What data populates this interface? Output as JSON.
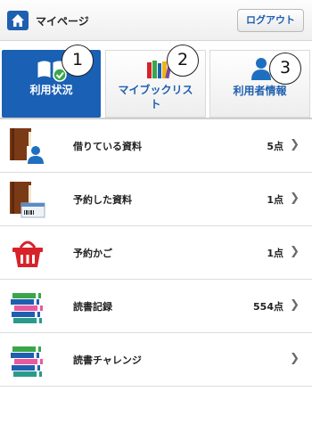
{
  "header": {
    "title": "マイページ",
    "logout_label": "ログアウト"
  },
  "tabs": [
    {
      "label": "利用状況",
      "marker": "1",
      "icon": "book-check-icon",
      "active": true
    },
    {
      "label_line1": "マイブックリス",
      "label_line2": "ト",
      "marker": "2",
      "icon": "bookshelf-icon",
      "active": false
    },
    {
      "label": "利用者情報",
      "marker": "3",
      "icon": "user-icon",
      "active": false
    }
  ],
  "items": [
    {
      "label": "借りている資料",
      "count": "5点",
      "icon": "book-user-icon"
    },
    {
      "label": "予約した資料",
      "count": "1点",
      "icon": "book-card-icon"
    },
    {
      "label": "予約かご",
      "count": "1点",
      "icon": "basket-icon"
    },
    {
      "label": "読書記録",
      "count": "554点",
      "icon": "book-stack-icon"
    },
    {
      "label": "読書チャレンジ",
      "count": "",
      "icon": "book-stack-challenge-icon"
    }
  ],
  "colors": {
    "accent": "#1a60b4",
    "link": "#1f5fb0",
    "basket": "#d8222a"
  }
}
